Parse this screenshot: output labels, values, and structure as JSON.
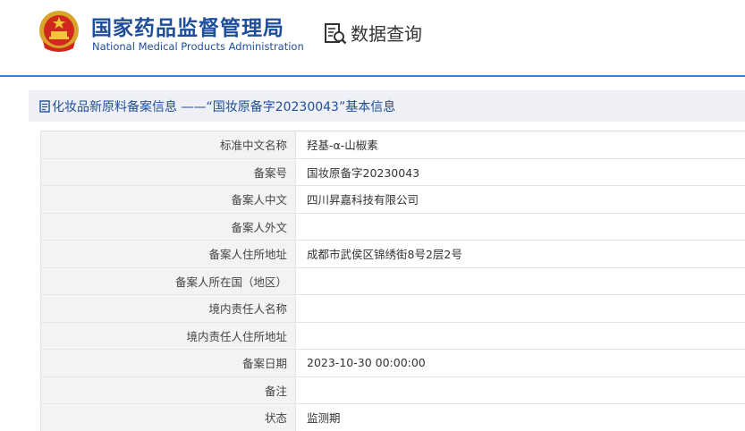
{
  "header": {
    "title_cn": "国家药品监督管理局",
    "title_en": "National Medical Products Administration",
    "query_label": "数据查询",
    "emblem_icon": "national-emblem-icon",
    "query_icon": "data-query-icon",
    "brand_color": "#1f4e9b",
    "accent_line_color": "#3d7ed3"
  },
  "panel": {
    "title": "化妆品新原料备案信息 ——“国妆原备字20230043”基本信息",
    "title_icon": "document-icon"
  },
  "rows": [
    {
      "label": "标准中文名称",
      "value": "羟基-α-山椒素"
    },
    {
      "label": "备案号",
      "value": "国妆原备字20230043"
    },
    {
      "label": "备案人中文",
      "value": "四川昇嘉科技有限公司"
    },
    {
      "label": "备案人外文",
      "value": ""
    },
    {
      "label": "备案人住所地址",
      "value": "成都市武侯区锦绣街8号2层2号"
    },
    {
      "label": "备案人所在国（地区）",
      "value": ""
    },
    {
      "label": "境内责任人名称",
      "value": ""
    },
    {
      "label": "境内责任人住所地址",
      "value": ""
    },
    {
      "label": "备案日期",
      "value": "2023-10-30 00:00:00"
    },
    {
      "label": "备注",
      "value": ""
    },
    {
      "label": "状态",
      "value": "监测期"
    }
  ]
}
